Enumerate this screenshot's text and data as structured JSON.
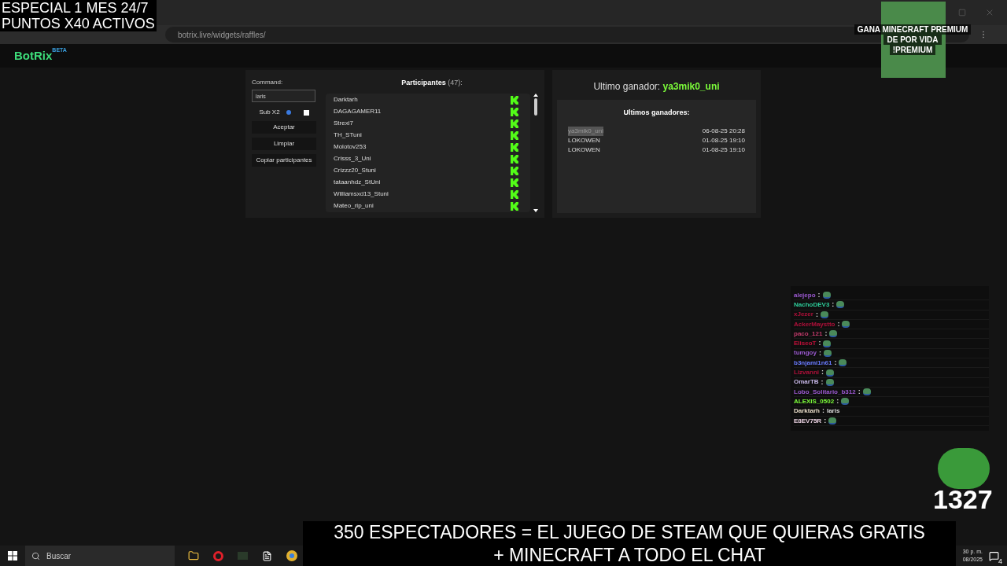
{
  "stream_overlay": {
    "top_left": [
      "ESPECIAL 1 MES 24/7",
      "PUNTOS X40 ACTIVOS"
    ],
    "top_right": [
      "GANA MINECRAFT PREMIUM",
      "DE POR VIDA",
      "!PREMIUM"
    ],
    "bottom": [
      "350 ESPECTADORES = EL JUEGO DE STEAM QUE QUIERAS GRATIS",
      "+ MINECRAFT A TODO EL CHAT"
    ],
    "counter": "1327"
  },
  "browser": {
    "address": "botrix.live/widgets/raffles/"
  },
  "header": {
    "logo": "BotRix",
    "badge": "BETA"
  },
  "controls": {
    "command_label": "Command:",
    "command_value": "laris",
    "sub_label": "Sub X2",
    "sub_checked": false,
    "buttons": [
      "Aceptar",
      "Limpiar",
      "Copiar participantes"
    ]
  },
  "participants": {
    "title": "Participantes",
    "count": "(47):",
    "items": [
      {
        "name": "Darktarh"
      },
      {
        "name": "DAGAGAMER11"
      },
      {
        "name": "Strexi7"
      },
      {
        "name": "TH_STuni"
      },
      {
        "name": "Molotov253"
      },
      {
        "name": "Crisss_3_Uni"
      },
      {
        "name": "Crizzz20_Stuni"
      },
      {
        "name": "tataanhdz_StUni"
      },
      {
        "name": "Williamsxd13_Stuni"
      },
      {
        "name": "Mateo_rip_uni"
      }
    ]
  },
  "last_winner": {
    "label": "Ultimo ganador:",
    "name": "ya3mik0_uni"
  },
  "winners": {
    "title": "Ultimos ganadores:",
    "rows": [
      {
        "name": "ya3mik0_uni",
        "date": "06-08-25 20:28",
        "highlighted": true
      },
      {
        "name": "LOKOWEN",
        "date": "01-08-25 19:10",
        "highlighted": false
      },
      {
        "name": "LOKOWEN",
        "date": "01-08-25 19:10",
        "highlighted": false
      }
    ]
  },
  "chat_separator": ":",
  "chat": [
    {
      "user": "alejepo",
      "color": "#9b59d0",
      "kind": "emote"
    },
    {
      "user": "NachoDEV3",
      "color": "#2ecc9a",
      "kind": "emote"
    },
    {
      "user": "xJezer",
      "color": "#b0103a",
      "kind": "emote"
    },
    {
      "user": "AckerMaystto",
      "color": "#b0103a",
      "kind": "emote"
    },
    {
      "user": "paco_121",
      "color": "#c03a6a",
      "kind": "emote"
    },
    {
      "user": "EliseoT",
      "color": "#c0103a",
      "kind": "emote"
    },
    {
      "user": "tumgoy",
      "color": "#9b59d0",
      "kind": "emote"
    },
    {
      "user": "b3njami1n61",
      "color": "#6a7bff",
      "kind": "emote"
    },
    {
      "user": "Lizvanni",
      "color": "#b0103a",
      "kind": "emote"
    },
    {
      "user": "OmarTB",
      "color": "#c8b8e8",
      "kind": "emote"
    },
    {
      "user": "Lobo_Solitario_b312",
      "color": "#9b59d0",
      "kind": "emote"
    },
    {
      "user": "ALEXIS_0502",
      "color": "#7cfc3a",
      "kind": "emote"
    },
    {
      "user": "Darktarh",
      "color": "#e8dcc8",
      "kind": "text",
      "message": "laris"
    },
    {
      "user": "E8EV75R",
      "color": "#e8d0e0",
      "kind": "emote"
    }
  ],
  "taskbar": {
    "search": "Buscar",
    "time": "30 p. m.",
    "date": "08/2025",
    "notifications": "4"
  }
}
